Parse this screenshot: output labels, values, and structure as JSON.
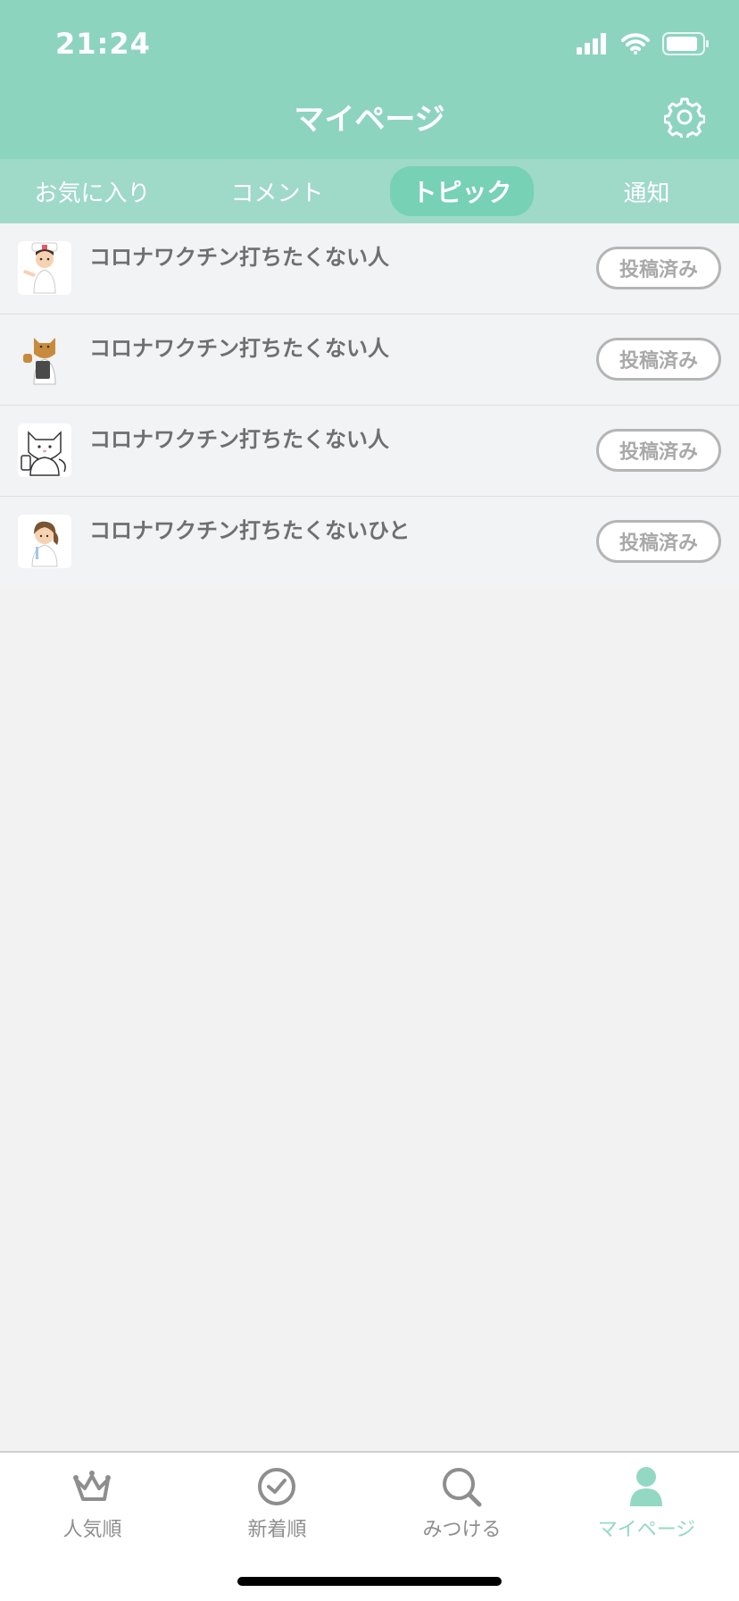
{
  "status_bar": {
    "time": "21:24",
    "icons": [
      "signal-icon",
      "wifi-icon",
      "battery-icon"
    ]
  },
  "header": {
    "title": "マイページ",
    "settings_icon": "gear-icon"
  },
  "tabs": [
    {
      "label": "お気に入り",
      "active": false
    },
    {
      "label": "コメント",
      "active": false
    },
    {
      "label": "トピック",
      "active": true
    },
    {
      "label": "通知",
      "active": false
    }
  ],
  "topics": [
    {
      "title": "コロナワクチン打ちたくない人",
      "status": "投稿済み",
      "avatar": "nurse-avatar-icon"
    },
    {
      "title": "コロナワクチン打ちたくない人",
      "status": "投稿済み",
      "avatar": "cat-doctor-avatar-icon"
    },
    {
      "title": "コロナワクチン打ちたくない人",
      "status": "投稿済み",
      "avatar": "white-cat-avatar-icon"
    },
    {
      "title": "コロナワクチン打ちたくないひと",
      "status": "投稿済み",
      "avatar": "nurse-syringe-avatar-icon"
    }
  ],
  "tabbar": [
    {
      "label": "人気順",
      "icon": "crown-icon",
      "active": false
    },
    {
      "label": "新着順",
      "icon": "clock-icon",
      "active": false
    },
    {
      "label": "みつける",
      "icon": "search-icon",
      "active": false
    },
    {
      "label": "マイページ",
      "icon": "person-icon",
      "active": true
    }
  ],
  "colors": {
    "header": "#8dd4be",
    "tabs_bg": "#9fd9c8",
    "active_tab_pill": "#77d1b4",
    "accent": "#93d8c3",
    "badge_border": "#b5b5b5"
  }
}
